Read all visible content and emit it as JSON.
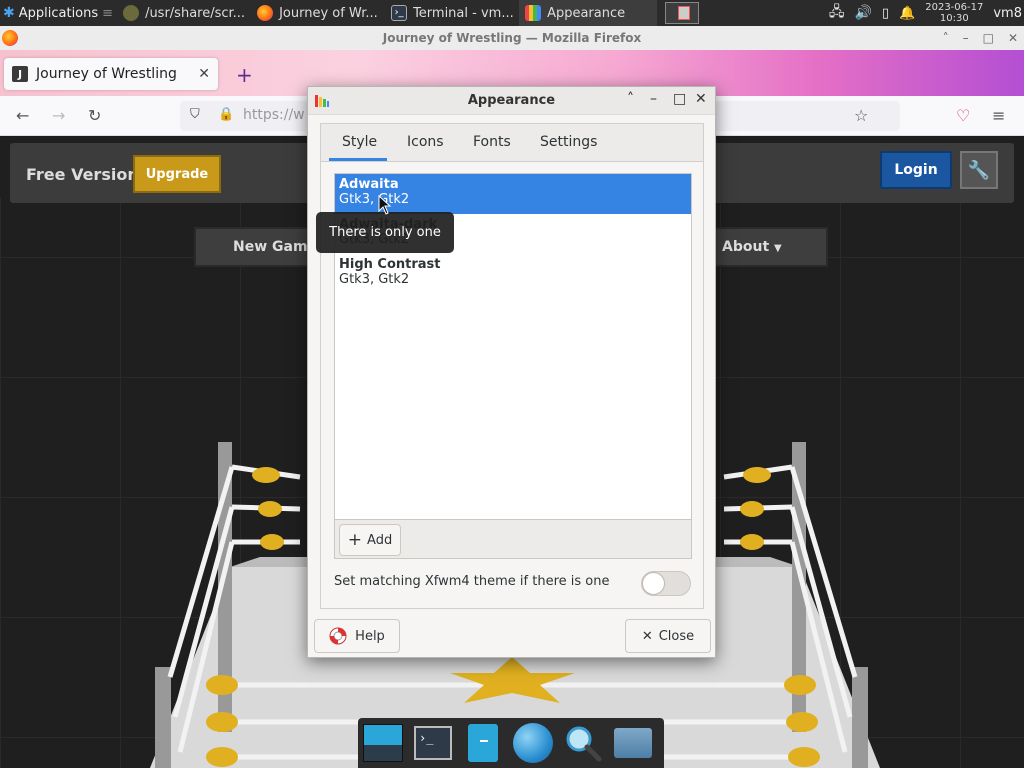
{
  "panel": {
    "applications_label": "Applications",
    "tasks": [
      {
        "label": "/usr/share/scr..."
      },
      {
        "label": "Journey of Wr..."
      },
      {
        "label": "Terminal - vm..."
      },
      {
        "label": "Appearance"
      }
    ],
    "clock_date": "2023-06-17",
    "clock_time": "10:30",
    "user": "vm8"
  },
  "firefox": {
    "window_title": "Journey of Wrestling — Mozilla Firefox",
    "tab_title": "Journey of Wrestling",
    "tab_favicon_letter": "J",
    "url": "https://w"
  },
  "site": {
    "free_version": "Free Version",
    "upgrade": "Upgrade",
    "login": "Login",
    "menu": {
      "new_game": "New Game",
      "about": "About"
    }
  },
  "dialog": {
    "title": "Appearance",
    "tabs": [
      "Style",
      "Icons",
      "Fonts",
      "Settings"
    ],
    "themes": [
      {
        "name": "Adwaita",
        "sub": "Gtk3, Gtk2"
      },
      {
        "name": "Adwaita-dark",
        "sub": "Gtk3, Gtk2"
      },
      {
        "name": "High Contrast",
        "sub": "Gtk3, Gtk2"
      }
    ],
    "add_label": "Add",
    "match_label": "Set matching Xfwm4 theme if there is one",
    "tooltip": "There is only one",
    "help_label": "Help",
    "close_label": "Close"
  },
  "colors": {
    "accent": "#3584e4",
    "upgrade": "#c99a1a",
    "login": "#1b57a0"
  }
}
